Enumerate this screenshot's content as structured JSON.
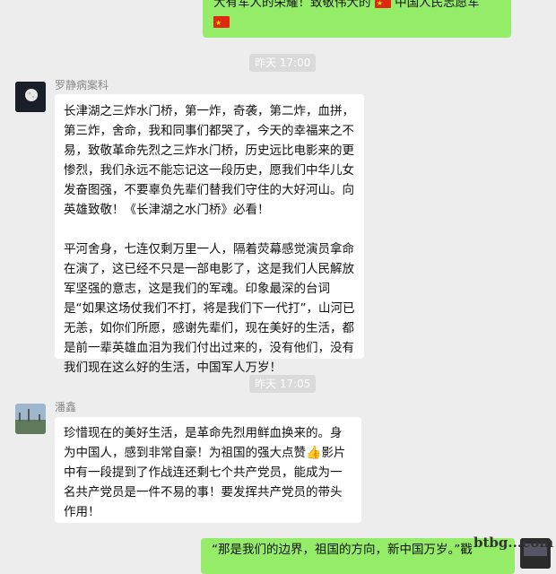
{
  "messages": [
    {
      "type": "outgoing",
      "text_tail": "大有军人的荣耀！致敬伟大的",
      "text_mid": "中国人民志愿军",
      "flag_icon": "china-flag-icon"
    },
    {
      "type": "timestamp",
      "text": "昨天 17:00"
    },
    {
      "type": "incoming",
      "sender": "罗静病案科",
      "paragraphs": [
        "长津湖之三炸水门桥，第一炸，奇袭，第二炸，血拼，第三炸，舍命，我和同事们都哭了，今天的幸福来之不易，致敬革命先烈之三炸水门桥，历史远比电影来的更惨烈，我们永远不能忘记这一段历史，愿我们中华儿女发奋图强，不要辜负先辈们替我们守住的大好河山。向英雄致敬！《长津湖之水门桥》必看！",
        "平河舍身，七连仅剩万里一人，隔着荧幕感觉演员拿命在演了，这已经不只是一部电影了，这是我们人民解放军坚强的意志，这是我们的军魂。印象最深的台词是“如果这场仗我们不打，将是我们下一代打”，山河已无恙，如你们所愿，感谢先辈们，现在美好的生活，都是前一辈英雄血泪为我们付出过来的，没有他们，没有我们现在这么好的生活，中国军人万岁！"
      ]
    },
    {
      "type": "timestamp",
      "text": "昨天 17:05"
    },
    {
      "type": "incoming",
      "sender": "潘鑫",
      "text_before": "珍惜现在的美好生活，是革命先烈用鲜血换来的。身为中国人，感到非常自豪！为祖国的强大点赞",
      "emoji_icon": "thumbs-up-icon",
      "text_after": "影片中有一段提到了作战连还剩七个共产党员，能成为一名共产党员是一件不易的事！要发挥共产党员的带头作用！"
    },
    {
      "type": "outgoing",
      "text": "“那是我们的边界，祖国的方向，新中国万岁。”戳"
    }
  ],
  "watermark": "btbg...com",
  "colors": {
    "background": "#ededed",
    "outgoing_bubble": "#95ec69",
    "incoming_bubble": "#ffffff",
    "timestamp_pill": "#dadada"
  }
}
